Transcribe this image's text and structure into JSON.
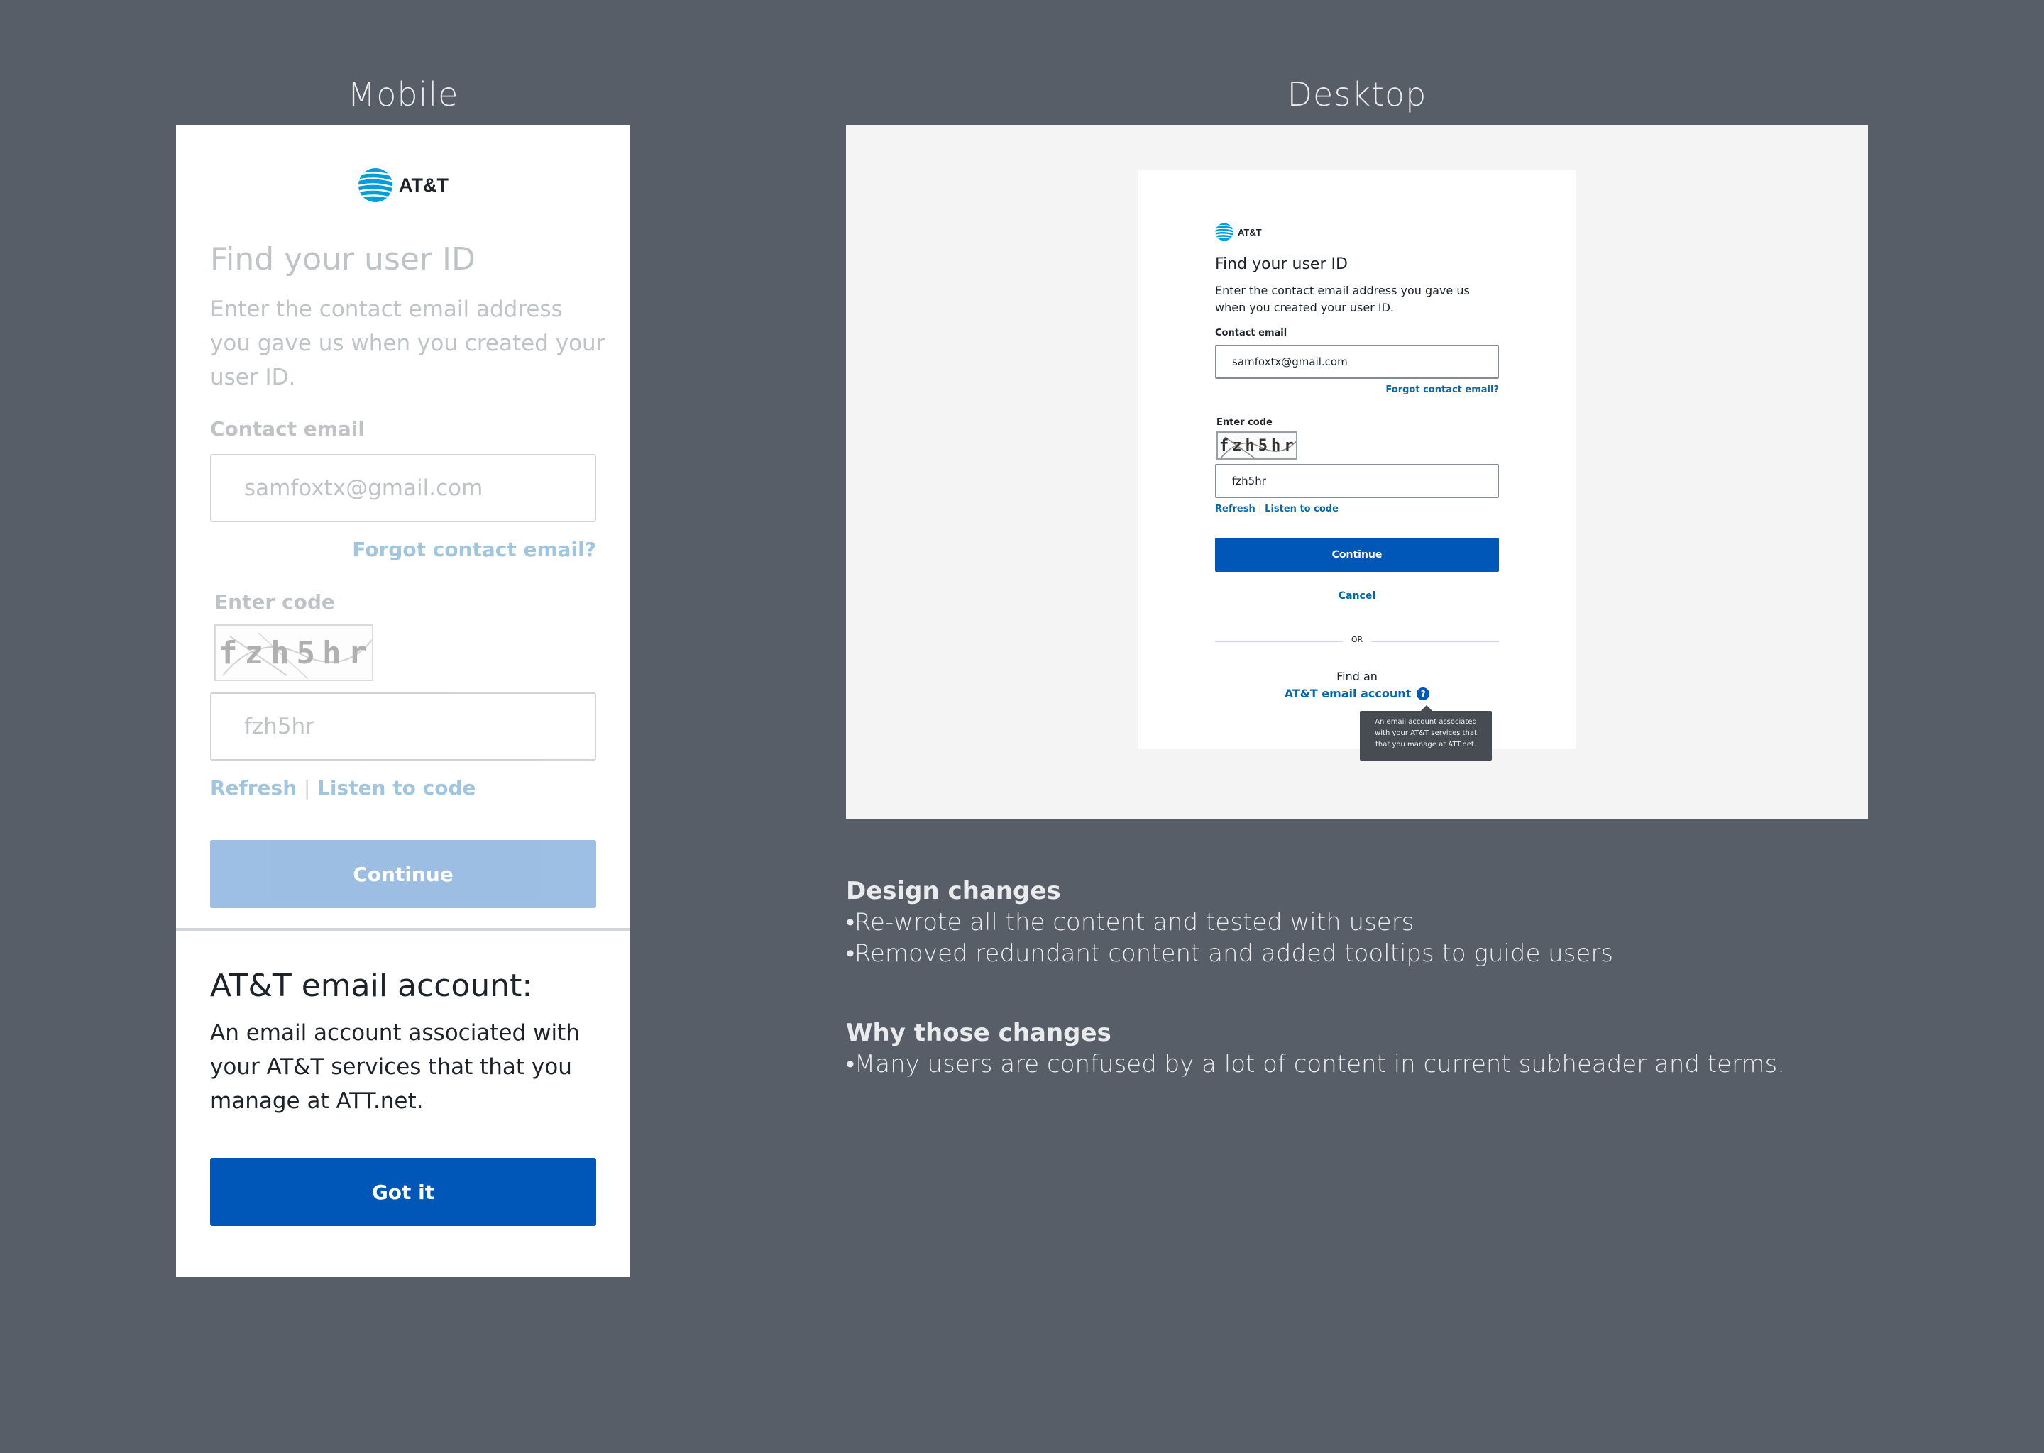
{
  "headings": {
    "mobile": "Mobile",
    "desktop": "Desktop"
  },
  "brand": {
    "logo_text": "AT&T",
    "primary": "#0057b8",
    "link": "#0568ae",
    "logo_icon": "att-globe-icon"
  },
  "mobile": {
    "title": "Find your user ID",
    "subtitle": "Enter the contact email address you gave us when you created your user ID.",
    "contact_label": "Contact email",
    "email_value": "samfoxtx@gmail.com",
    "forgot_link": "Forgot contact email?",
    "code_label": "Enter code",
    "captcha_text": "fzh5hr",
    "code_value": "fzh5hr",
    "refresh_link": "Refresh",
    "separator": "|",
    "listen_link": "Listen to code",
    "continue_label": "Continue",
    "sheet_title": "AT&T email account:",
    "sheet_text": "An email account associated with your AT&T services that that you manage at ATT.net.",
    "got_it_label": "Got it"
  },
  "desktop": {
    "title": "Find your user ID",
    "subtitle": "Enter the contact email address you gave us when you created your user ID.",
    "contact_label": "Contact email",
    "email_value": "samfoxtx@gmail.com",
    "forgot_link": "Forgot contact email?",
    "code_label": "Enter code",
    "captcha_text": "fzh5hr",
    "code_value": "fzh5hr",
    "refresh_link": "Refresh",
    "separator": "|",
    "listen_link": "Listen to code",
    "continue_label": "Continue",
    "cancel_label": "Cancel",
    "or_label": "OR",
    "find_an": "Find an",
    "email_account_link": "AT&T email account",
    "help_icon_glyph": "?",
    "tooltip_text": "An email account associated with your AT&T services that that you manage at ATT.net."
  },
  "notes": {
    "design_heading": "Design changes",
    "design_items": [
      "•Re-wrote all the content and tested with users",
      "•Removed redundant content and added tooltips to guide users"
    ],
    "why_heading": "Why those changes",
    "why_items": [
      "•Many users are confused by a lot of content in current subheader and terms."
    ]
  }
}
